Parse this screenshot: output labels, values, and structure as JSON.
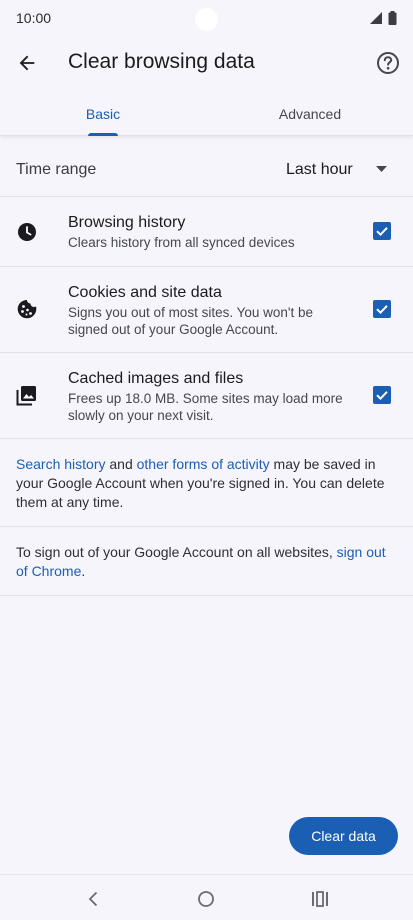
{
  "status_bar": {
    "time": "10:00",
    "icons": [
      "wifi-icon",
      "battery-icon"
    ]
  },
  "app_bar": {
    "title": "Clear browsing data",
    "back_icon": "arrow-back-icon",
    "help_icon": "help-icon"
  },
  "tabs": [
    {
      "label": "Basic",
      "selected": true
    },
    {
      "label": "Advanced",
      "selected": false
    }
  ],
  "time_range": {
    "label": "Time range",
    "value": "Last hour"
  },
  "options": [
    {
      "icon": "clock-icon",
      "title": "Browsing history",
      "description": "Clears history from all synced devices",
      "checked": true
    },
    {
      "icon": "cookie-icon",
      "title": "Cookies and site data",
      "description": "Signs you out of most sites. You won't be signed out of your Google Account.",
      "checked": true
    },
    {
      "icon": "image-icon",
      "title": "Cached images and files",
      "description": "Frees up 18.0 MB. Some sites may load more slowly on your next visit.",
      "checked": true
    }
  ],
  "info": {
    "link1": "Search history",
    "text1": " and ",
    "link2": "other forms of activity",
    "text2": " may be saved in your Google Account when you're signed in. You can delete them at any time."
  },
  "signout": {
    "text": "To sign out of your Google Account on all websites, ",
    "link": "sign out of Chrome",
    "suffix": "."
  },
  "clear_button": "Clear data",
  "colors": {
    "accent": "#1a5fb4",
    "background": "#f6f5fb"
  }
}
